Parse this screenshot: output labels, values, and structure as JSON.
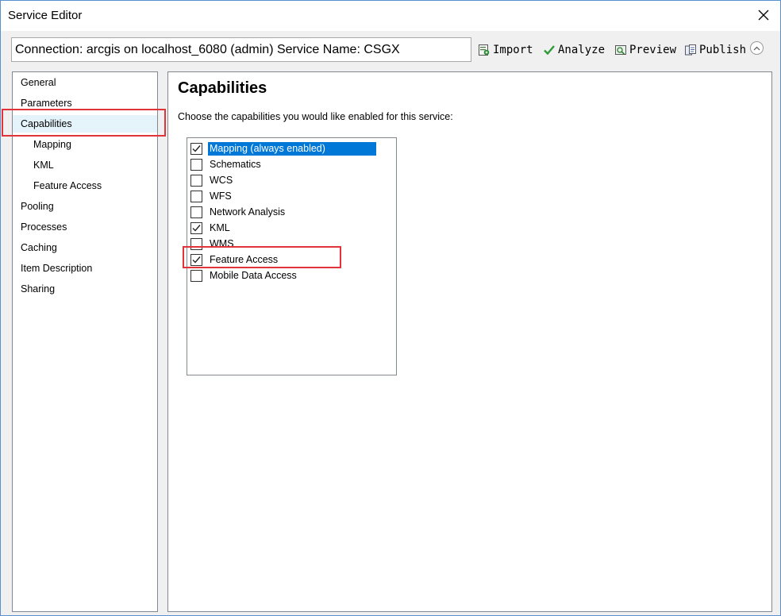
{
  "window": {
    "title": "Service Editor"
  },
  "toolbar": {
    "connection_text": "Connection: arcgis on localhost_6080 (admin)   Service Name: CSGX",
    "import_label": "Import",
    "analyze_label": "Analyze",
    "preview_label": "Preview",
    "publish_label": "Publish"
  },
  "sidebar": {
    "items": [
      {
        "label": "General"
      },
      {
        "label": "Parameters"
      },
      {
        "label": "Capabilities",
        "selected": true
      },
      {
        "label": "Mapping"
      },
      {
        "label": "KML"
      },
      {
        "label": "Feature Access"
      },
      {
        "label": "Pooling"
      },
      {
        "label": "Processes"
      },
      {
        "label": "Caching"
      },
      {
        "label": "Item Description"
      },
      {
        "label": "Sharing"
      }
    ]
  },
  "main": {
    "title": "Capabilities",
    "description": "Choose the capabilities you would like enabled for this service:",
    "capabilities": [
      {
        "label": "Mapping (always enabled)",
        "checked": true,
        "highlighted": true
      },
      {
        "label": "Schematics",
        "checked": false
      },
      {
        "label": "WCS",
        "checked": false
      },
      {
        "label": "WFS",
        "checked": false
      },
      {
        "label": "Network Analysis",
        "checked": false
      },
      {
        "label": "KML",
        "checked": true
      },
      {
        "label": "WMS",
        "checked": false
      },
      {
        "label": "Feature Access",
        "checked": true
      },
      {
        "label": "Mobile Data Access",
        "checked": false
      }
    ]
  },
  "colors": {
    "selection": "#0078d7",
    "annotation_red": "#e0333a",
    "nav_selected_bg": "#e5f3fb"
  }
}
